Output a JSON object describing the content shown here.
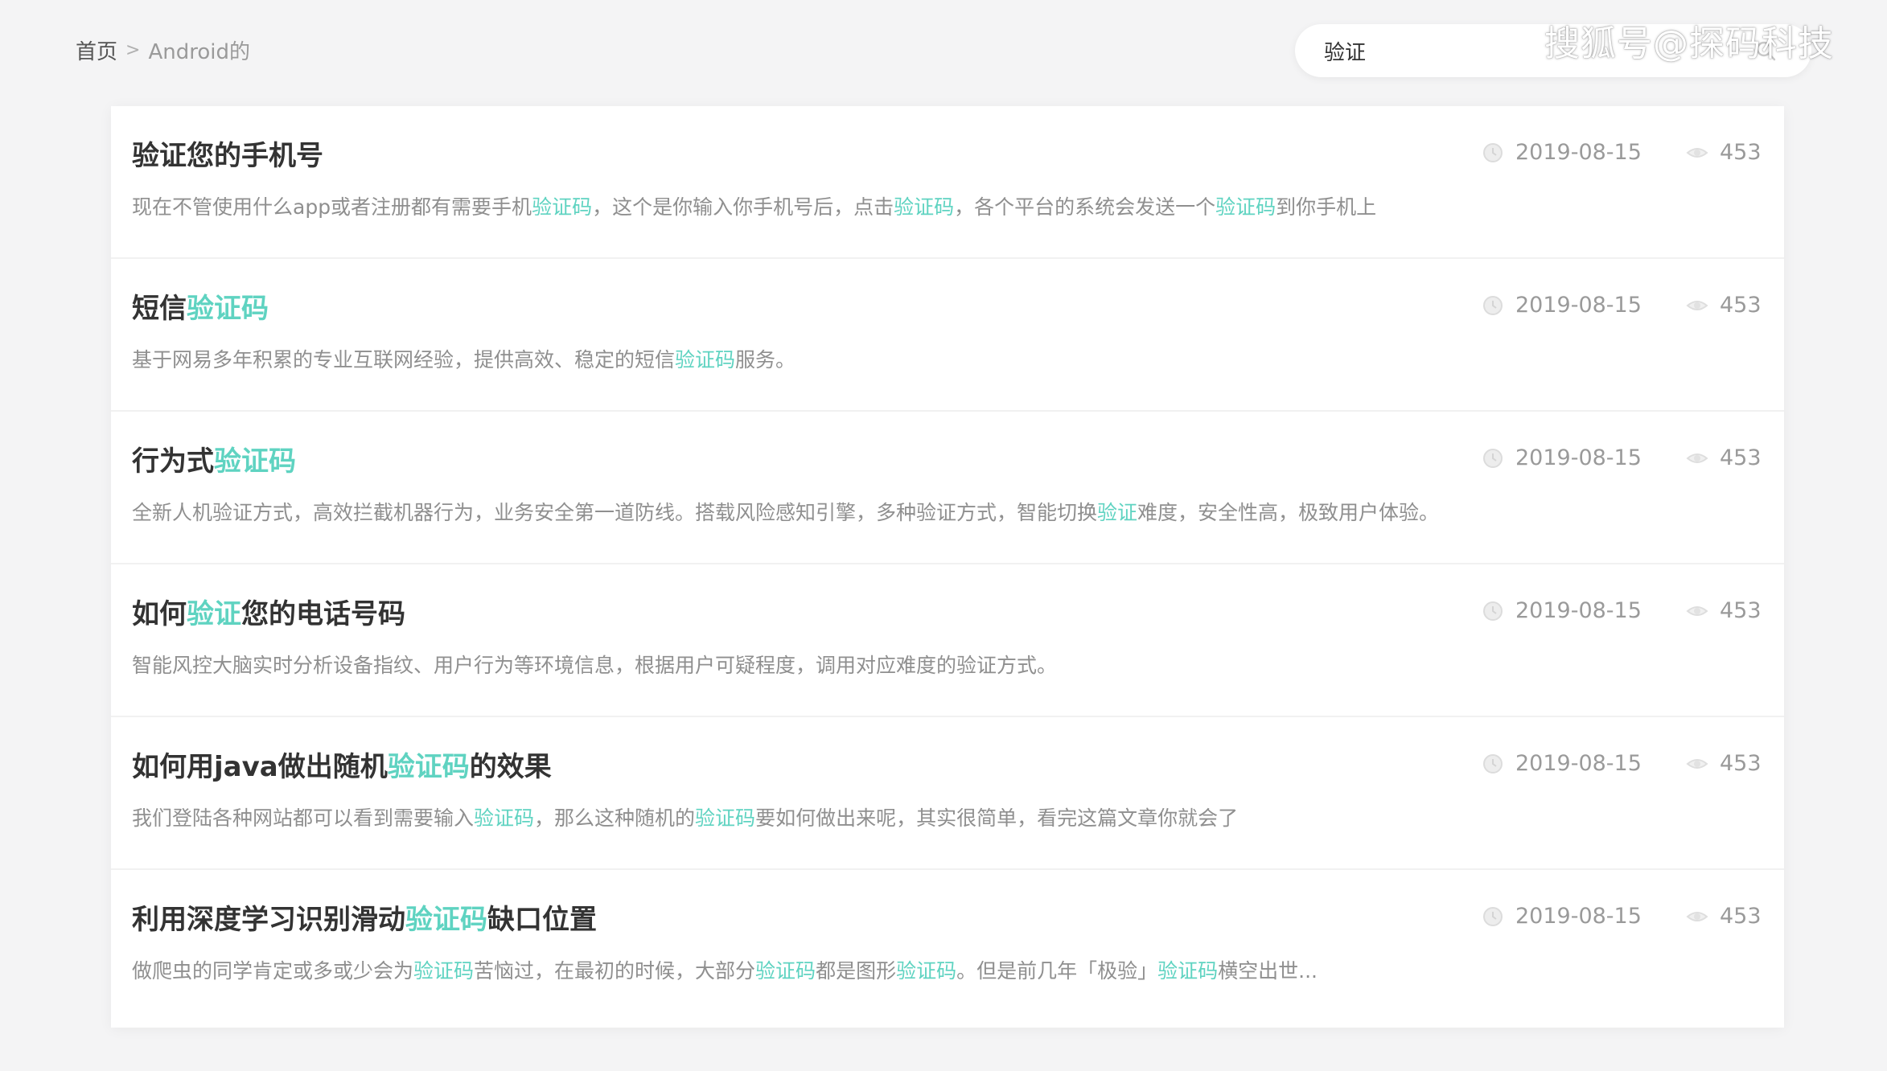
{
  "breadcrumb": {
    "home": "首页",
    "separator": ">",
    "current": "Android的"
  },
  "search": {
    "value": "验证"
  },
  "watermark": "搜狐号@探码科技",
  "colors": {
    "highlight": "#5fd3c1",
    "title": "#333333",
    "summary": "#8f8f8f",
    "meta": "#9a9a9a"
  },
  "icons": {
    "search": "search-icon",
    "date": "clock-icon",
    "views": "eye-icon"
  },
  "results": [
    {
      "title": [
        {
          "text": "验证您的手机号",
          "hl": false
        }
      ],
      "summary": [
        {
          "text": "现在不管使用什么app或者注册都有需要手机",
          "hl": false
        },
        {
          "text": "验证码",
          "hl": true
        },
        {
          "text": "，这个是你输入你手机号后，点击",
          "hl": false
        },
        {
          "text": "验证码",
          "hl": true
        },
        {
          "text": "，各个平台的系统会发送一个",
          "hl": false
        },
        {
          "text": "验证码",
          "hl": true
        },
        {
          "text": "到你手机上",
          "hl": false
        }
      ],
      "date": "2019-08-15",
      "views": "453"
    },
    {
      "title": [
        {
          "text": "短信",
          "hl": false
        },
        {
          "text": "验证码",
          "hl": true
        }
      ],
      "summary": [
        {
          "text": "基于网易多年积累的专业互联网经验，提供高效、稳定的短信",
          "hl": false
        },
        {
          "text": "验证码",
          "hl": true
        },
        {
          "text": "服务。",
          "hl": false
        }
      ],
      "date": "2019-08-15",
      "views": "453"
    },
    {
      "title": [
        {
          "text": "行为式",
          "hl": false
        },
        {
          "text": "验证码",
          "hl": true
        }
      ],
      "summary": [
        {
          "text": "全新人机验证方式，高效拦截机器行为，业务安全第一道防线。搭载风险感知引擎，多种验证方式，智能切换",
          "hl": false
        },
        {
          "text": "验证",
          "hl": true
        },
        {
          "text": "难度，安全性高，极致用户体验。",
          "hl": false
        }
      ],
      "date": "2019-08-15",
      "views": "453"
    },
    {
      "title": [
        {
          "text": "如何",
          "hl": false
        },
        {
          "text": "验证",
          "hl": true
        },
        {
          "text": "您的电话号码",
          "hl": false
        }
      ],
      "summary": [
        {
          "text": "智能风控大脑实时分析设备指纹、用户行为等环境信息，根据用户可疑程度，调用对应难度的验证方式。",
          "hl": false
        }
      ],
      "date": "2019-08-15",
      "views": "453"
    },
    {
      "title": [
        {
          "text": "如何用java做出随机",
          "hl": false
        },
        {
          "text": "验证码",
          "hl": true
        },
        {
          "text": "的效果",
          "hl": false
        }
      ],
      "summary": [
        {
          "text": "我们登陆各种网站都可以看到需要输入",
          "hl": false
        },
        {
          "text": "验证码",
          "hl": true
        },
        {
          "text": "，那么这种随机的",
          "hl": false
        },
        {
          "text": "验证码",
          "hl": true
        },
        {
          "text": "要如何做出来呢，其实很简单，看完这篇文章你就会了",
          "hl": false
        }
      ],
      "date": "2019-08-15",
      "views": "453"
    },
    {
      "title": [
        {
          "text": "利用深度学习识别滑动",
          "hl": false
        },
        {
          "text": "验证码",
          "hl": true
        },
        {
          "text": "缺口位置",
          "hl": false
        }
      ],
      "summary": [
        {
          "text": "做爬虫的同学肯定或多或少会为",
          "hl": false
        },
        {
          "text": "验证码",
          "hl": true
        },
        {
          "text": "苦恼过，在最初的时候，大部分",
          "hl": false
        },
        {
          "text": "验证码",
          "hl": true
        },
        {
          "text": "都是图形",
          "hl": false
        },
        {
          "text": "验证码",
          "hl": true
        },
        {
          "text": "。但是前几年「极验」",
          "hl": false
        },
        {
          "text": "验证码",
          "hl": true
        },
        {
          "text": "横空出世...",
          "hl": false
        }
      ],
      "date": "2019-08-15",
      "views": "453"
    }
  ]
}
